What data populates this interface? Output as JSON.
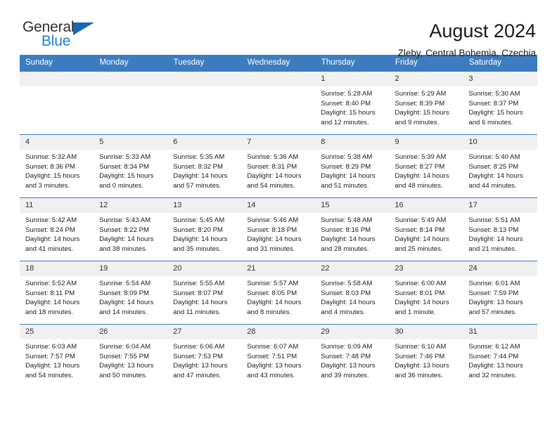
{
  "brand": {
    "line1": "General",
    "line2": "Blue",
    "accent_color": "#1668b3",
    "text_color": "#2e2e2e"
  },
  "header": {
    "title": "August 2024",
    "subtitle": "Zleby, Central Bohemia, Czechia"
  },
  "calendar": {
    "header_bg": "#3b7dc0",
    "daynum_bg": "#f0f0f0",
    "weekdays": [
      "Sunday",
      "Monday",
      "Tuesday",
      "Wednesday",
      "Thursday",
      "Friday",
      "Saturday"
    ],
    "weeks": [
      [
        {
          "day": "",
          "blank": true
        },
        {
          "day": "",
          "blank": true
        },
        {
          "day": "",
          "blank": true
        },
        {
          "day": "",
          "blank": true
        },
        {
          "day": "1",
          "sunrise": "Sunrise: 5:28 AM",
          "sunset": "Sunset: 8:40 PM",
          "daylight": "Daylight: 15 hours and 12 minutes."
        },
        {
          "day": "2",
          "sunrise": "Sunrise: 5:29 AM",
          "sunset": "Sunset: 8:39 PM",
          "daylight": "Daylight: 15 hours and 9 minutes."
        },
        {
          "day": "3",
          "sunrise": "Sunrise: 5:30 AM",
          "sunset": "Sunset: 8:37 PM",
          "daylight": "Daylight: 15 hours and 6 minutes."
        }
      ],
      [
        {
          "day": "4",
          "sunrise": "Sunrise: 5:32 AM",
          "sunset": "Sunset: 8:36 PM",
          "daylight": "Daylight: 15 hours and 3 minutes."
        },
        {
          "day": "5",
          "sunrise": "Sunrise: 5:33 AM",
          "sunset": "Sunset: 8:34 PM",
          "daylight": "Daylight: 15 hours and 0 minutes."
        },
        {
          "day": "6",
          "sunrise": "Sunrise: 5:35 AM",
          "sunset": "Sunset: 8:32 PM",
          "daylight": "Daylight: 14 hours and 57 minutes."
        },
        {
          "day": "7",
          "sunrise": "Sunrise: 5:36 AM",
          "sunset": "Sunset: 8:31 PM",
          "daylight": "Daylight: 14 hours and 54 minutes."
        },
        {
          "day": "8",
          "sunrise": "Sunrise: 5:38 AM",
          "sunset": "Sunset: 8:29 PM",
          "daylight": "Daylight: 14 hours and 51 minutes."
        },
        {
          "day": "9",
          "sunrise": "Sunrise: 5:39 AM",
          "sunset": "Sunset: 8:27 PM",
          "daylight": "Daylight: 14 hours and 48 minutes."
        },
        {
          "day": "10",
          "sunrise": "Sunrise: 5:40 AM",
          "sunset": "Sunset: 8:25 PM",
          "daylight": "Daylight: 14 hours and 44 minutes."
        }
      ],
      [
        {
          "day": "11",
          "sunrise": "Sunrise: 5:42 AM",
          "sunset": "Sunset: 8:24 PM",
          "daylight": "Daylight: 14 hours and 41 minutes."
        },
        {
          "day": "12",
          "sunrise": "Sunrise: 5:43 AM",
          "sunset": "Sunset: 8:22 PM",
          "daylight": "Daylight: 14 hours and 38 minutes."
        },
        {
          "day": "13",
          "sunrise": "Sunrise: 5:45 AM",
          "sunset": "Sunset: 8:20 PM",
          "daylight": "Daylight: 14 hours and 35 minutes."
        },
        {
          "day": "14",
          "sunrise": "Sunrise: 5:46 AM",
          "sunset": "Sunset: 8:18 PM",
          "daylight": "Daylight: 14 hours and 31 minutes."
        },
        {
          "day": "15",
          "sunrise": "Sunrise: 5:48 AM",
          "sunset": "Sunset: 8:16 PM",
          "daylight": "Daylight: 14 hours and 28 minutes."
        },
        {
          "day": "16",
          "sunrise": "Sunrise: 5:49 AM",
          "sunset": "Sunset: 8:14 PM",
          "daylight": "Daylight: 14 hours and 25 minutes."
        },
        {
          "day": "17",
          "sunrise": "Sunrise: 5:51 AM",
          "sunset": "Sunset: 8:13 PM",
          "daylight": "Daylight: 14 hours and 21 minutes."
        }
      ],
      [
        {
          "day": "18",
          "sunrise": "Sunrise: 5:52 AM",
          "sunset": "Sunset: 8:11 PM",
          "daylight": "Daylight: 14 hours and 18 minutes."
        },
        {
          "day": "19",
          "sunrise": "Sunrise: 5:54 AM",
          "sunset": "Sunset: 8:09 PM",
          "daylight": "Daylight: 14 hours and 14 minutes."
        },
        {
          "day": "20",
          "sunrise": "Sunrise: 5:55 AM",
          "sunset": "Sunset: 8:07 PM",
          "daylight": "Daylight: 14 hours and 11 minutes."
        },
        {
          "day": "21",
          "sunrise": "Sunrise: 5:57 AM",
          "sunset": "Sunset: 8:05 PM",
          "daylight": "Daylight: 14 hours and 8 minutes."
        },
        {
          "day": "22",
          "sunrise": "Sunrise: 5:58 AM",
          "sunset": "Sunset: 8:03 PM",
          "daylight": "Daylight: 14 hours and 4 minutes."
        },
        {
          "day": "23",
          "sunrise": "Sunrise: 6:00 AM",
          "sunset": "Sunset: 8:01 PM",
          "daylight": "Daylight: 14 hours and 1 minute."
        },
        {
          "day": "24",
          "sunrise": "Sunrise: 6:01 AM",
          "sunset": "Sunset: 7:59 PM",
          "daylight": "Daylight: 13 hours and 57 minutes."
        }
      ],
      [
        {
          "day": "25",
          "sunrise": "Sunrise: 6:03 AM",
          "sunset": "Sunset: 7:57 PM",
          "daylight": "Daylight: 13 hours and 54 minutes."
        },
        {
          "day": "26",
          "sunrise": "Sunrise: 6:04 AM",
          "sunset": "Sunset: 7:55 PM",
          "daylight": "Daylight: 13 hours and 50 minutes."
        },
        {
          "day": "27",
          "sunrise": "Sunrise: 6:06 AM",
          "sunset": "Sunset: 7:53 PM",
          "daylight": "Daylight: 13 hours and 47 minutes."
        },
        {
          "day": "28",
          "sunrise": "Sunrise: 6:07 AM",
          "sunset": "Sunset: 7:51 PM",
          "daylight": "Daylight: 13 hours and 43 minutes."
        },
        {
          "day": "29",
          "sunrise": "Sunrise: 6:09 AM",
          "sunset": "Sunset: 7:48 PM",
          "daylight": "Daylight: 13 hours and 39 minutes."
        },
        {
          "day": "30",
          "sunrise": "Sunrise: 6:10 AM",
          "sunset": "Sunset: 7:46 PM",
          "daylight": "Daylight: 13 hours and 36 minutes."
        },
        {
          "day": "31",
          "sunrise": "Sunrise: 6:12 AM",
          "sunset": "Sunset: 7:44 PM",
          "daylight": "Daylight: 13 hours and 32 minutes."
        }
      ]
    ]
  }
}
